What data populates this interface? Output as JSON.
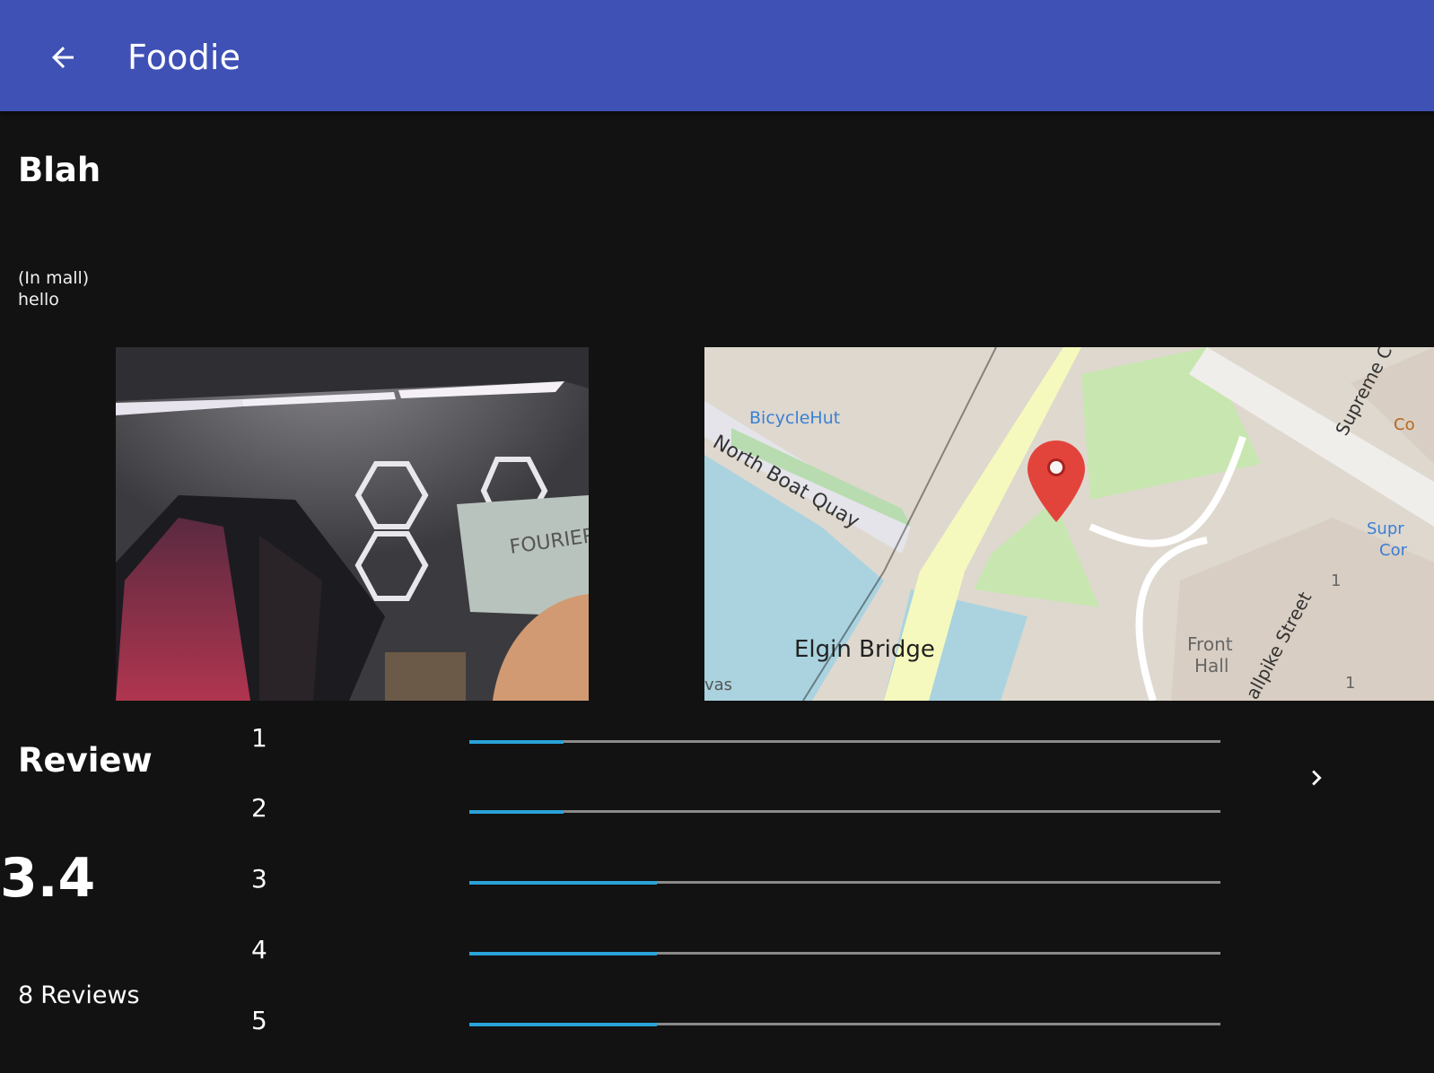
{
  "app_bar": {
    "title": "Foodie",
    "color": "#3f51b5",
    "back_icon": "arrow-back-icon"
  },
  "place": {
    "name": "Blah",
    "location_note": "(In mall)",
    "description": "hello"
  },
  "map_labels": {
    "poi": "BicycleHut",
    "street_1": "North Boat Quay",
    "bridge": "Elgin Bridge",
    "street_2": "Supreme C",
    "street_3": "allpike Street",
    "building": "Front",
    "building_2": "Hall",
    "stop": "Supr",
    "stop_2": "Cor",
    "fragment": "vas",
    "fragment_2": "Co",
    "number_1": "1",
    "number_2": "1"
  },
  "review": {
    "heading": "Review",
    "average": "3.4",
    "count": "8",
    "count_label": "Reviews",
    "accent_color": "#29a3d9",
    "breakdown": [
      {
        "label": "1",
        "fraction": 0.125
      },
      {
        "label": "2",
        "fraction": 0.125
      },
      {
        "label": "3",
        "fraction": 0.25
      },
      {
        "label": "4",
        "fraction": 0.25
      },
      {
        "label": "5",
        "fraction": 0.25
      }
    ],
    "more_icon": "chevron-right-icon"
  }
}
